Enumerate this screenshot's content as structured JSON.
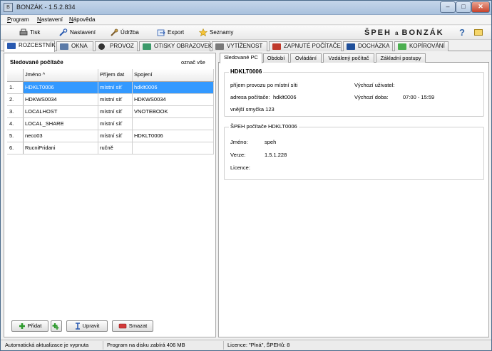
{
  "window": {
    "title": "BONZÁK - 1.5.2.834",
    "app_icon_glyph": "B",
    "controls": {
      "minimize": "–",
      "maximize": "□",
      "close": "✕"
    }
  },
  "menu": {
    "items": [
      "Program",
      "Nastavení",
      "Nápověda"
    ]
  },
  "toolbar": {
    "print_label": "Tisk",
    "settings_label": "Nastavení",
    "maintenance_label": "Údržba",
    "export_label": "Export",
    "lists_label": "Seznamy",
    "brand_left": "ŠPEH",
    "brand_mid": "a",
    "brand_right": "BONZÁK",
    "help_glyph": "?"
  },
  "main_tabs": [
    {
      "label": "ROZCESTNÍK",
      "icon": "signpost-icon",
      "color": "#2a5ab0"
    },
    {
      "label": "OKNA",
      "icon": "windows-icon",
      "color": "#5a7aa8"
    },
    {
      "label": "PROVOZ",
      "icon": "traffic-icon",
      "color": "#333333"
    },
    {
      "label": "OTISKY OBRAZOVEK",
      "icon": "screenshot-icon",
      "color": "#3b9a6a"
    },
    {
      "label": "VYTÍŽENOST",
      "icon": "load-icon",
      "color": "#7a7a7a"
    },
    {
      "label": "ZAPNUTÉ POČÍTAČE",
      "icon": "monitor-icon",
      "color": "#c0392b"
    },
    {
      "label": "DOCHÁZKA",
      "icon": "calendar-icon",
      "color": "#1f4f9a"
    },
    {
      "label": "KOPÍROVÁNÍ",
      "icon": "copy-icon",
      "color": "#4caf50"
    }
  ],
  "left": {
    "title": "Sledované počítače",
    "mark_all": "označ vše",
    "columns": [
      "",
      "Jméno ^",
      "Příjem dat",
      "Spojení"
    ],
    "rows": [
      {
        "n": "1.",
        "name": "HDKLT0006",
        "recv": "místní síť",
        "conn": "hdklt0006",
        "selected": true
      },
      {
        "n": "2.",
        "name": "HDKWS0034",
        "recv": "místní síť",
        "conn": "HDKWS0034"
      },
      {
        "n": "3.",
        "name": "LOCALHOST",
        "recv": "místní síť",
        "conn": "VNOTEBOOK"
      },
      {
        "n": "4.",
        "name": "LOCAL_SHARE",
        "recv": "místní síť",
        "conn": ""
      },
      {
        "n": "5.",
        "name": "neco03",
        "recv": "místní síť",
        "conn": "HDKLT0006"
      },
      {
        "n": "6.",
        "name": "RucniPridani",
        "recv": "ručně",
        "conn": ""
      }
    ],
    "buttons": {
      "add": "Přidat",
      "edit": "Upravit",
      "delete": "Smazat"
    }
  },
  "right": {
    "tabs": [
      "Sledované PC",
      "Období",
      "Ovládání",
      "Vzdálený počítač",
      "Základní postupy"
    ],
    "pc_box": {
      "title": "HDKLT0006",
      "receive": "příjem provozu po místní síti",
      "address_label": "adresa počítače:",
      "address_value": "hdklt0006",
      "external_loop": "vnější smyčka 123",
      "default_user_label": "Výchozí uživatel:",
      "default_user_value": "",
      "default_time_label": "Výchozí doba:",
      "default_time_value": "07:00 - 15:59"
    },
    "speh_box": {
      "title": "ŠPEH počítače HDKLT0006",
      "name_label": "Jméno:",
      "name_value": "speh",
      "version_label": "Verze:",
      "version_value": "1.5.1.228",
      "licence_label": "Licence:",
      "licence_value": ""
    }
  },
  "status": {
    "auto_update": "Automatická aktualizace je vypnuta",
    "disk": "Program na disku zabírá 406 MB",
    "licence": "Licence: \"Plná\", ŠPEHů: 8"
  }
}
